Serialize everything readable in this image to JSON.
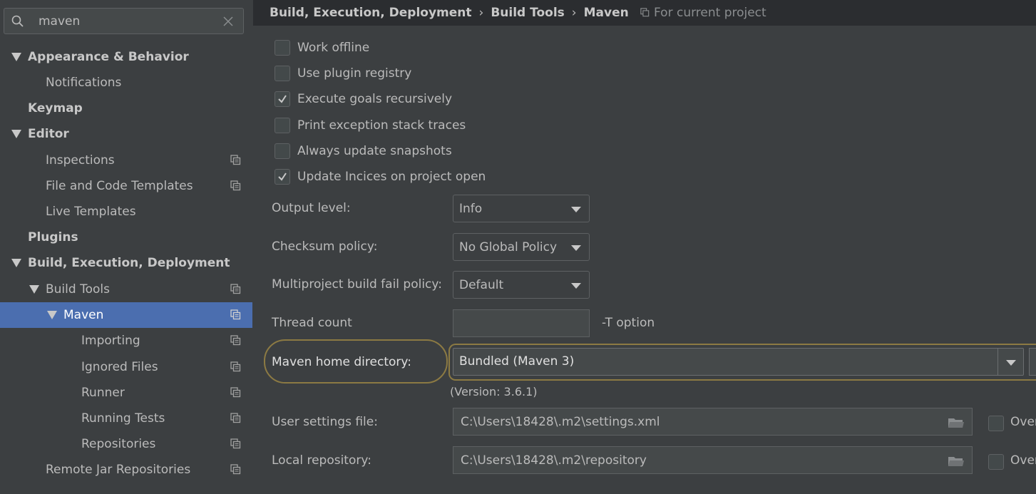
{
  "search": {
    "value": "maven"
  },
  "sidebar": {
    "items": [
      {
        "label": "Appearance & Behavior"
      },
      {
        "label": "Notifications"
      },
      {
        "label": "Keymap"
      },
      {
        "label": "Editor"
      },
      {
        "label": "Inspections"
      },
      {
        "label": "File and Code Templates"
      },
      {
        "label": "Live Templates"
      },
      {
        "label": "Plugins"
      },
      {
        "label": "Build, Execution, Deployment"
      },
      {
        "label": "Build Tools"
      },
      {
        "label": "Maven"
      },
      {
        "label": "Importing"
      },
      {
        "label": "Ignored Files"
      },
      {
        "label": "Runner"
      },
      {
        "label": "Running Tests"
      },
      {
        "label": "Repositories"
      },
      {
        "label": "Remote Jar Repositories"
      }
    ],
    "selected": "Maven"
  },
  "breadcrumb": {
    "items": [
      "Build, Execution, Deployment",
      "Build Tools",
      "Maven"
    ],
    "separator": "›",
    "scope": "For current project"
  },
  "options": [
    {
      "label": "Work offline",
      "checked": false
    },
    {
      "label": "Use plugin registry",
      "checked": false
    },
    {
      "label": "Execute goals recursively",
      "checked": true
    },
    {
      "label": "Print exception stack traces",
      "checked": false
    },
    {
      "label": "Always update snapshots",
      "checked": false
    },
    {
      "label": "Update Incices on project open",
      "checked": true
    }
  ],
  "fields": {
    "output_level": {
      "label": "Output level:",
      "value": "Info"
    },
    "checksum_policy": {
      "label": "Checksum policy:",
      "value": "No Global Policy"
    },
    "multiproject": {
      "label": "Multiproject build fail policy:",
      "value": "Default"
    },
    "thread_count": {
      "label": "Thread count",
      "value": "",
      "hint": "-T option"
    },
    "maven_home": {
      "label": "Maven home directory:",
      "value": "Bundled (Maven 3)",
      "version": "(Version: 3.6.1)"
    },
    "user_settings": {
      "label": "User settings file:",
      "value": "C:\\Users\\18428\\.m2\\settings.xml",
      "override": "Over"
    },
    "local_repo": {
      "label": "Local repository:",
      "value": "C:\\Users\\18428\\.m2\\repository",
      "override": "Over"
    }
  },
  "colors": {
    "selection": "#4b6eaf",
    "highlight": "#8c7a43",
    "background": "#3c3f41"
  }
}
